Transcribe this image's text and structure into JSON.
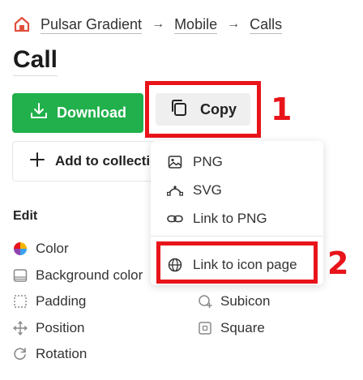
{
  "breadcrumb": {
    "items": [
      "Pulsar Gradient",
      "Mobile",
      "Calls"
    ],
    "separator": "→"
  },
  "page": {
    "title": "Call"
  },
  "actions": {
    "download_label": "Download",
    "copy_label": "Copy",
    "add_label": "Add to collecti"
  },
  "annotations": {
    "badge_1": "1",
    "badge_2": "2"
  },
  "edit": {
    "section_label": "Edit",
    "left_options": [
      {
        "label": "Color",
        "icon": "color-wheel-icon"
      },
      {
        "label": "Background color",
        "icon": "background-icon"
      },
      {
        "label": "Padding",
        "icon": "padding-icon"
      },
      {
        "label": "Position",
        "icon": "move-icon"
      },
      {
        "label": "Rotation",
        "icon": "rotate-icon"
      }
    ],
    "right_options": [
      {
        "label": "Subicon",
        "icon": "subicon-icon"
      },
      {
        "label": "Square",
        "icon": "square-icon"
      }
    ]
  },
  "copy_menu": {
    "items": [
      {
        "label": "PNG",
        "icon": "image-icon"
      },
      {
        "label": "SVG",
        "icon": "vector-icon"
      },
      {
        "label": "Link to PNG",
        "icon": "link-icon"
      },
      {
        "label": "Link to icon page",
        "icon": "globe-icon"
      }
    ]
  },
  "colors": {
    "accent_green": "#21b04b",
    "annotation_red": "#e8141a",
    "home_icon": "#e0503c"
  }
}
